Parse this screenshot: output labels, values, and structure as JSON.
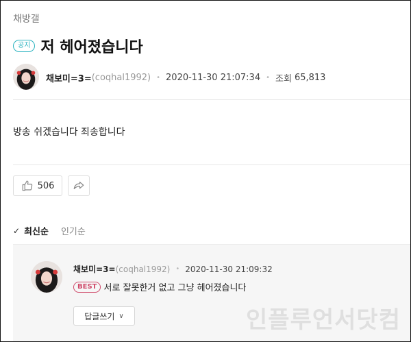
{
  "board": {
    "name": "채방갤"
  },
  "post": {
    "badge": "공지",
    "title": "저 헤어졌습니다",
    "author_name": "채보미=3=",
    "author_id": "(coqhal1992)",
    "datetime": "2020-11-30 21:07:34",
    "views_label": "조회",
    "views": "65,813",
    "body": "방송 쉬겠습니다 죄송합니다",
    "likes": "506"
  },
  "sort": {
    "active": "최신순",
    "inactive": "인기순"
  },
  "comment": {
    "author_name": "채보미=3=",
    "author_id": "(coqhal1992)",
    "datetime": "2020-11-30 21:09:32",
    "badge": "BEST",
    "text": "서로 잘못한거 없고 그냥 헤어졌습니다",
    "reply_label": "답글쓰기"
  },
  "watermark": "인플루언서닷컴",
  "colors": {
    "accent": "#2bb3c0",
    "best": "#d04a6a",
    "comment_bg": "#f6f6f6"
  },
  "icons": [
    "thumbs-up-icon",
    "share-icon",
    "check-icon",
    "chevron-down-icon"
  ]
}
